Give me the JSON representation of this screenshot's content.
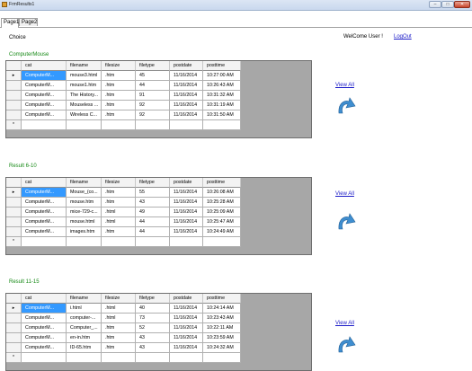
{
  "window": {
    "title": "FrmResults1",
    "min_glyph": "–",
    "max_glyph": "□",
    "close_glyph": "✕"
  },
  "tabs": [
    {
      "label": "Page1"
    },
    {
      "label": "Page2"
    }
  ],
  "header": {
    "choice_label": "Choice",
    "welcome_text": "WelCome User !",
    "logout_label": "LogOut"
  },
  "row_indicators": {
    "current": "▸",
    "new": "*"
  },
  "grid_columns": [
    "cat",
    "filename",
    "filesize",
    "filetype",
    "postdate",
    "posttime"
  ],
  "sections": [
    {
      "title": "ComputerMouse",
      "view_all": "View All",
      "rows": [
        [
          "ComputerM...",
          "mouse3.html",
          ".htm",
          "45",
          "11/16/2014",
          "10:27:00 AM"
        ],
        [
          "ComputerM...",
          "mouse1.htm",
          ".htm",
          "44",
          "11/16/2014",
          "10:26:43 AM"
        ],
        [
          "ComputerM...",
          "The History...",
          ".htm",
          "91",
          "11/16/2014",
          "10:31:32 AM"
        ],
        [
          "ComputerM...",
          "Mouseless ...",
          ".htm",
          "92",
          "11/16/2014",
          "10:31:19 AM"
        ],
        [
          "ComputerM...",
          "Wireless C...",
          ".htm",
          "92",
          "11/16/2014",
          "10:31:50 AM"
        ]
      ]
    },
    {
      "title": "Result 6-10",
      "view_all": "View All",
      "rows": [
        [
          "ComputerM...",
          "Mouse_(co...",
          ".htm",
          "55",
          "11/16/2014",
          "10:26:08 AM"
        ],
        [
          "ComputerM...",
          "mouse.htm",
          ".htm",
          "43",
          "11/16/2014",
          "10:25:28 AM"
        ],
        [
          "ComputerM...",
          "mice-729-c...",
          ".html",
          "49",
          "11/16/2014",
          "10:25:09 AM"
        ],
        [
          "ComputerM...",
          "mouse.html",
          ".html",
          "44",
          "11/16/2014",
          "10:25:47 AM"
        ],
        [
          "ComputerM...",
          "images.htm",
          ".htm",
          "44",
          "11/16/2014",
          "10:24:49 AM"
        ]
      ]
    },
    {
      "title": "Result 11-15",
      "view_all": "View All",
      "rows": [
        [
          "ComputerM...",
          "i.html",
          ".html",
          "40",
          "11/16/2014",
          "10:24:14 AM"
        ],
        [
          "ComputerM...",
          "computer-...",
          ".html",
          "73",
          "11/16/2014",
          "10:23:43 AM"
        ],
        [
          "ComputerM...",
          "Computer_...",
          ".htm",
          "52",
          "11/16/2014",
          "10:22:11 AM"
        ],
        [
          "ComputerM...",
          "en-in.htm",
          ".htm",
          "43",
          "11/16/2014",
          "10:23:59 AM"
        ],
        [
          "ComputerM...",
          "ID-65.htm",
          ".htm",
          "43",
          "11/16/2014",
          "10:24:32 AM"
        ]
      ]
    }
  ],
  "colors": {
    "selection": "#3399ff",
    "section_title": "#178a17",
    "link": "#1a1ac8",
    "grid_background": "#a7a7a7",
    "icon": "#3f8ed0"
  }
}
